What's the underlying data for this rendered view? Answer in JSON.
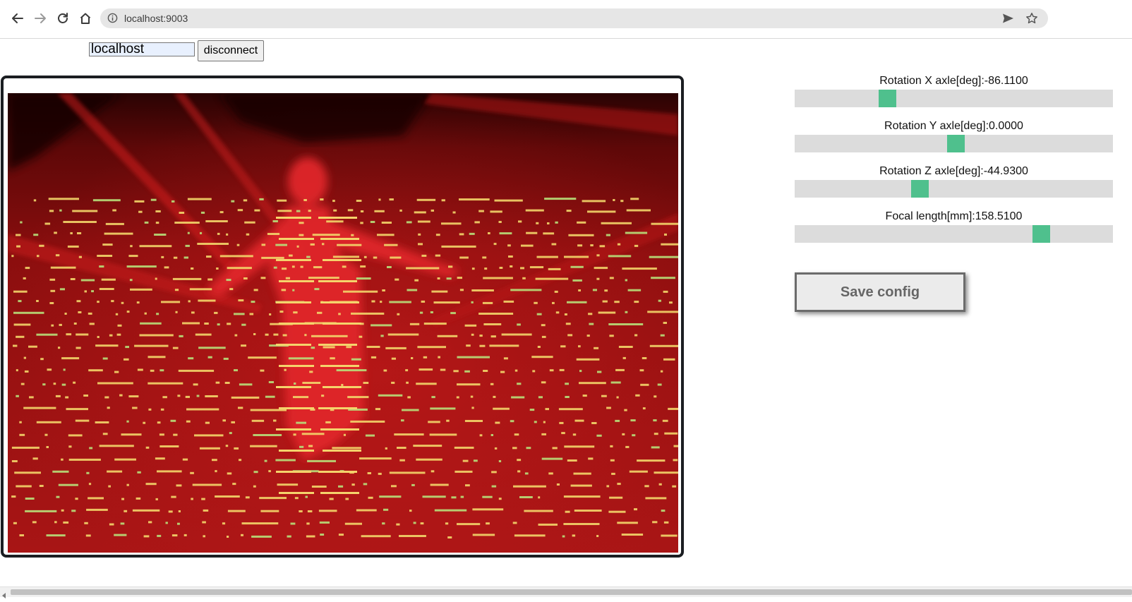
{
  "browser": {
    "url": "localhost:9003"
  },
  "connection": {
    "host_value": "localhost",
    "disconnect_label": "disconnect"
  },
  "sliders": [
    {
      "label": "Rotation X axle[deg]:-86.1100",
      "position": 0.28
    },
    {
      "label": "Rotation Y axle[deg]:0.0000",
      "position": 0.506
    },
    {
      "label": "Rotation Z axle[deg]:-44.9300",
      "position": 0.388
    },
    {
      "label": "Focal length[mm]:158.5100",
      "position": 0.791
    }
  ],
  "save_label": "Save config",
  "colors": {
    "slider_thumb": "#4fc08d",
    "slider_track": "#dcdcdc",
    "frame_border": "#1b1e22"
  },
  "icons": {
    "back": "arrow-left-icon",
    "forward": "arrow-right-icon",
    "reload": "reload-icon",
    "home": "home-icon",
    "info": "info-icon",
    "send": "send-icon",
    "bookmark": "star-icon"
  }
}
